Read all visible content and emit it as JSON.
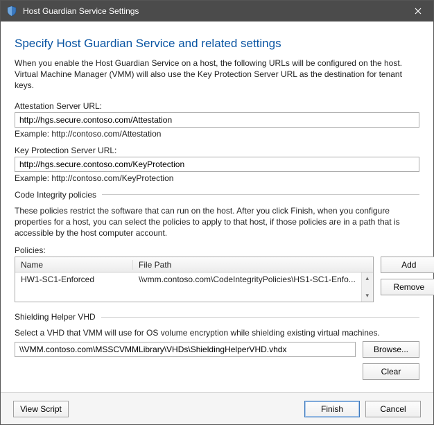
{
  "window": {
    "title": "Host Guardian Service Settings"
  },
  "heading": "Specify Host Guardian Service and related settings",
  "intro": "When you enable the Host Guardian Service on a host, the following URLs will be configured on the host. Virtual Machine Manager (VMM) will also use the Key Protection Server URL as the destination for tenant keys.",
  "attestation": {
    "label": "Attestation Server URL:",
    "value": "http://hgs.secure.contoso.com/Attestation",
    "example": "Example: http://contoso.com/Attestation"
  },
  "keyprotection": {
    "label": "Key Protection Server URL:",
    "value": "http://hgs.secure.contoso.com/KeyProtection",
    "example": "Example: http://contoso.com/KeyProtection"
  },
  "codeIntegrity": {
    "group_label": "Code Integrity policies",
    "text": "These policies restrict the software that can run on the host. After you click Finish, when you configure properties for a host, you can select the policies to apply to that host, if those policies are in a path that is accessible by the host computer account.",
    "policies_label": "Policies:",
    "cols": {
      "name": "Name",
      "path": "File Path"
    },
    "rows": [
      {
        "name": "HW1-SC1-Enforced",
        "path": "\\\\vmm.contoso.com\\CodeIntegrityPolicies\\HS1-SC1-Enfo..."
      }
    ],
    "add_label": "Add",
    "remove_label": "Remove"
  },
  "shielding": {
    "group_label": "Shielding Helper VHD",
    "text": "Select a VHD that VMM will use for OS volume encryption while shielding existing virtual machines.",
    "value": "\\\\VMM.contoso.com\\MSSCVMMLibrary\\VHDs\\ShieldingHelperVHD.vhdx",
    "browse_label": "Browse...",
    "clear_label": "Clear"
  },
  "footer": {
    "view_script": "View Script",
    "finish": "Finish",
    "cancel": "Cancel"
  }
}
